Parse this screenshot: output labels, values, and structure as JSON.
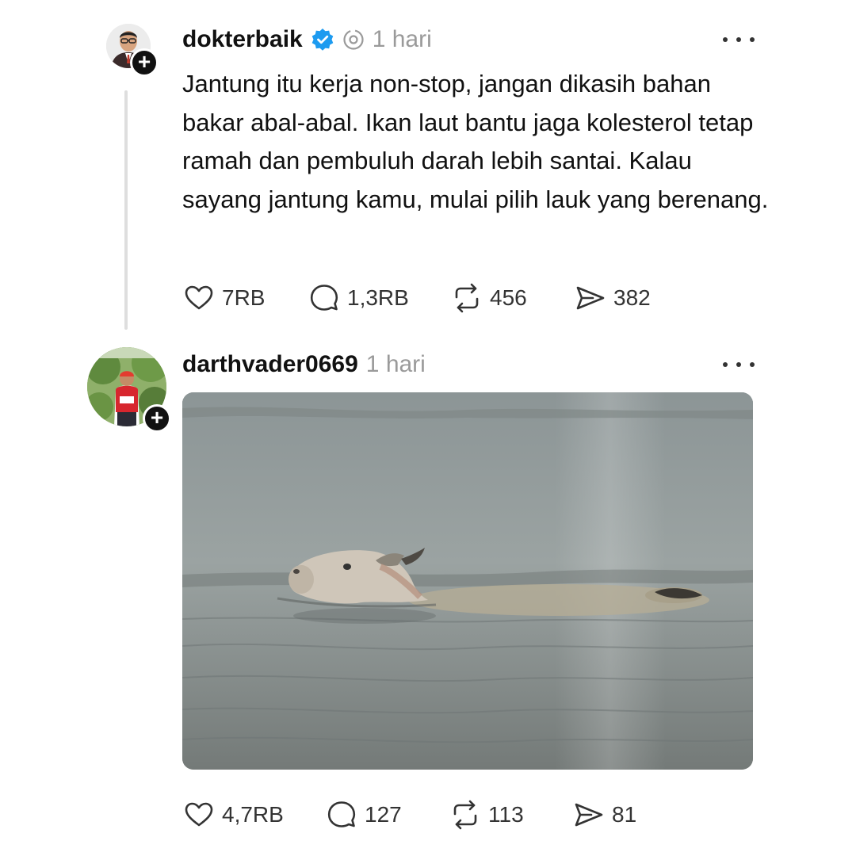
{
  "posts": [
    {
      "username": "dokterbaik",
      "time": "1 hari",
      "verified": true,
      "avatar_icon": "profile-photo",
      "text": "Jantung itu kerja non-stop, jangan dikasih bahan bakar abal-abal. Ikan laut bantu jaga kolesterol tetap ramah dan pembuluh darah lebih santai. Kalau sayang jantung kamu, mulai pilih lauk yang berenang.",
      "stats": {
        "likes": "7RB",
        "replies": "1,3RB",
        "reposts": "456",
        "shares": "382"
      }
    },
    {
      "username": "darthvader0669",
      "time": "1 hari",
      "verified": false,
      "avatar_icon": "profile-photo",
      "image_icon": "photo-cow-swimming-in-water",
      "stats": {
        "likes": "4,7RB",
        "replies": "127",
        "reposts": "113",
        "shares": "81"
      }
    }
  ],
  "colors": {
    "text": "#111111",
    "muted": "#9a9a9a",
    "verified": "#1d9bf0",
    "thread_line": "#dedede"
  },
  "icons": [
    "heart-icon",
    "comment-icon",
    "repost-icon",
    "share-icon",
    "more-icon",
    "verified-icon",
    "threads-icon",
    "follow-plus-icon"
  ]
}
